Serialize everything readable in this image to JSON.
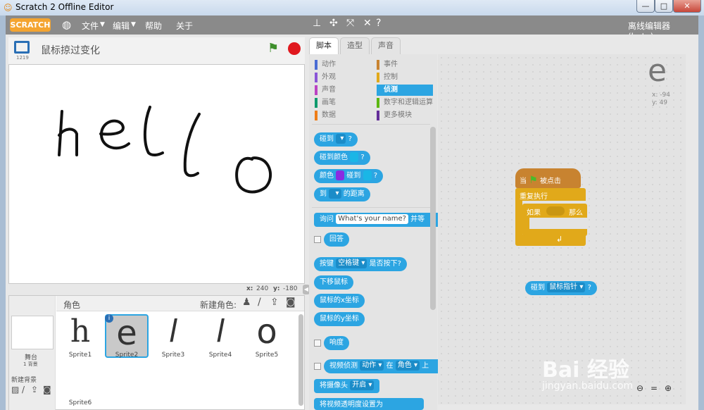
{
  "window": {
    "title": "Scratch 2 Offline Editor",
    "min": "—",
    "max": "□",
    "close": "✕"
  },
  "menu": {
    "logo": "SCRATCH",
    "file": "文件",
    "edit": "编辑",
    "help": "帮助",
    "about": "关于",
    "mode": "离线编辑器 (beta)"
  },
  "stage": {
    "project_title": "鼠标掠过变化",
    "version": "1219",
    "x_label": "x:",
    "x_value": "240",
    "y_label": "y:",
    "y_value": "-180",
    "hello_text": "hello"
  },
  "tabs": {
    "scripts": "脚本",
    "costumes": "造型",
    "sounds": "声音"
  },
  "categories": {
    "left": [
      {
        "label": "动作",
        "color": "#4a6cd4"
      },
      {
        "label": "外观",
        "color": "#8a55d7"
      },
      {
        "label": "声音",
        "color": "#bb42c3"
      },
      {
        "label": "画笔",
        "color": "#0e9a6c"
      },
      {
        "label": "数据",
        "color": "#ee7d16"
      }
    ],
    "right": [
      {
        "label": "事件",
        "color": "#c88330"
      },
      {
        "label": "控制",
        "color": "#e1a91a"
      },
      {
        "label": "侦测",
        "color": "#2ca5e2"
      },
      {
        "label": "数字和逻辑运算",
        "color": "#5cb712"
      },
      {
        "label": "更多模块",
        "color": "#632d99"
      }
    ]
  },
  "blocks": {
    "touching": "碰到",
    "touching_color": "碰到颜色",
    "color": "颜色",
    "is_touching": "碰到",
    "distance_to": "到",
    "distance_suffix": "的距离",
    "ask": "询问",
    "ask_default": "What's your name?",
    "ask_suffix": "并等",
    "answer": "回答",
    "key": "按键",
    "key_value": "空格键",
    "key_suffix": "是否按下?",
    "mouse_down": "下移鼠标",
    "mouse_x": "鼠标的x坐标",
    "mouse_y": "鼠标的y坐标",
    "loudness": "响度",
    "video": "视频侦测",
    "video_opt": "动作",
    "video_on": "在",
    "video_target": "角色",
    "video_on2": "上",
    "camera": "将摄像头",
    "camera_opt": "开启",
    "camera2": "将视频透明度设置为",
    "q": "?"
  },
  "script": {
    "when": "当",
    "clicked": "被点击",
    "forever": "重复执行",
    "if": "如果",
    "then": "那么",
    "touching": "碰到",
    "target": "鼠标指针",
    "q": "?"
  },
  "sprite_info": {
    "x": "x: -94",
    "y": "y: 49"
  },
  "sprites_panel": {
    "title": "角色",
    "new_sprite": "新建角色:",
    "stage_label": "舞台",
    "stage_sub": "1 背景",
    "new_backdrop": "新建背景"
  },
  "sprites": [
    {
      "name": "Sprite1",
      "glyph": "h"
    },
    {
      "name": "Sprite2",
      "glyph": "e"
    },
    {
      "name": "Sprite3",
      "glyph": "l"
    },
    {
      "name": "Sprite4",
      "glyph": "l"
    },
    {
      "name": "Sprite5",
      "glyph": "o"
    },
    {
      "name": "Sprite6",
      "glyph": ""
    }
  ],
  "watermark": {
    "brand": "Bai 经验",
    "url": "jingyan.baidu.com"
  }
}
